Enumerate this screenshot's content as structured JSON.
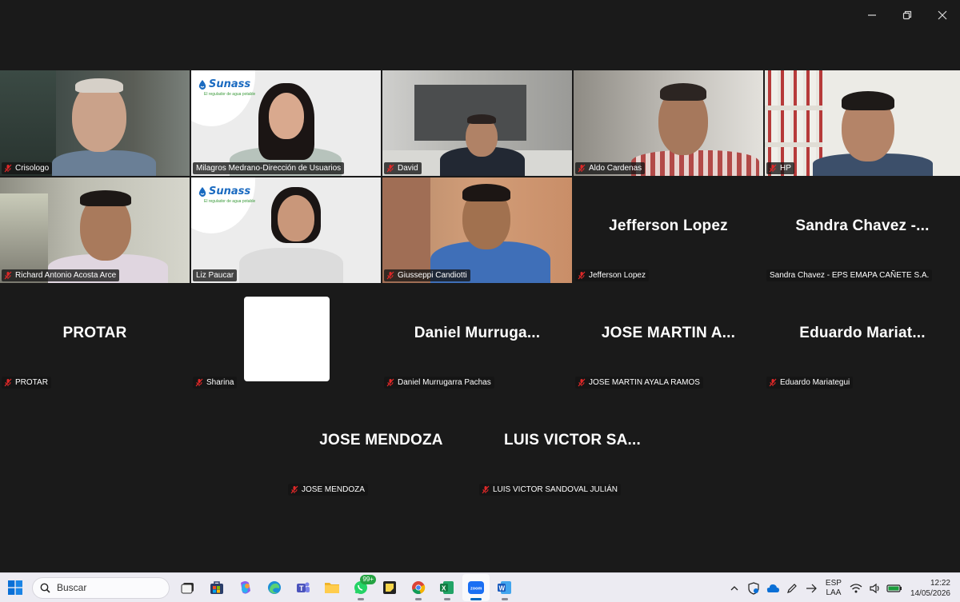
{
  "window": {
    "minimize_label": "–",
    "restore_icon": "restore-icon",
    "close_label": "✕"
  },
  "participants": [
    {
      "name": "Crisologo",
      "muted": true,
      "video": true
    },
    {
      "name": "Milagros Medrano-Dirección de Usuarios",
      "muted": false,
      "video": true,
      "active_speaker": true
    },
    {
      "name": "David",
      "muted": true,
      "video": true
    },
    {
      "name": "Aldo Cardenas",
      "muted": true,
      "video": true
    },
    {
      "name": "HP",
      "muted": true,
      "video": true
    },
    {
      "name": "Richard Antonio Acosta Arce",
      "muted": true,
      "video": true
    },
    {
      "name": "Liz Paucar",
      "muted": false,
      "video": true
    },
    {
      "name": "Giusseppi Candiotti",
      "muted": true,
      "video": true
    },
    {
      "name": "Jefferson Lopez",
      "display": "Jefferson Lopez",
      "muted": true,
      "video": false
    },
    {
      "name": "Sandra Chavez - EPS EMAPA CAÑETE S.A.",
      "display": "Sandra  Chavez  -...",
      "muted": false,
      "video": false
    },
    {
      "name": "PROTAR",
      "display": "PROTAR",
      "muted": true,
      "video": false
    },
    {
      "name": "Sharina",
      "muted": true,
      "video": false
    },
    {
      "name": "Daniel Murrugarra Pachas",
      "display": "Daniel  Murruga...",
      "muted": true,
      "video": false
    },
    {
      "name": "JOSE MARTIN AYALA RAMOS",
      "display": "JOSE MARTIN A...",
      "muted": true,
      "video": false
    },
    {
      "name": "Eduardo Mariategui",
      "display": "Eduardo  Mariat...",
      "muted": true,
      "video": false
    },
    {
      "name": "JOSE MENDOZA",
      "display": "JOSE MENDOZA",
      "muted": true,
      "video": false
    },
    {
      "name": "LUIS VICTOR SANDOVAL JULIÁN",
      "display": "LUIS  VICTOR  SA...",
      "muted": true,
      "video": false
    }
  ],
  "sunass": {
    "brand": "Sunass",
    "tagline": "El regulador de agua potable"
  },
  "taskbar": {
    "search_placeholder": "Buscar",
    "whatsapp_badge": "99+",
    "apps": [
      "file-explorer-icon",
      "store-icon",
      "copilot-icon",
      "edge-icon",
      "teams-icon",
      "folder-icon",
      "whatsapp-icon",
      "sticky-notes-icon",
      "chrome-icon",
      "excel-icon",
      "zoom-icon",
      "word-icon"
    ],
    "zoom_label": "zoom",
    "lang_top": "ESP",
    "lang_bottom": "LAA",
    "time": "12:22",
    "date": "14/05/2026"
  },
  "colors": {
    "active_speaker": "#2bd171",
    "muted_icon": "#e02828",
    "background": "#1a1a1a"
  }
}
